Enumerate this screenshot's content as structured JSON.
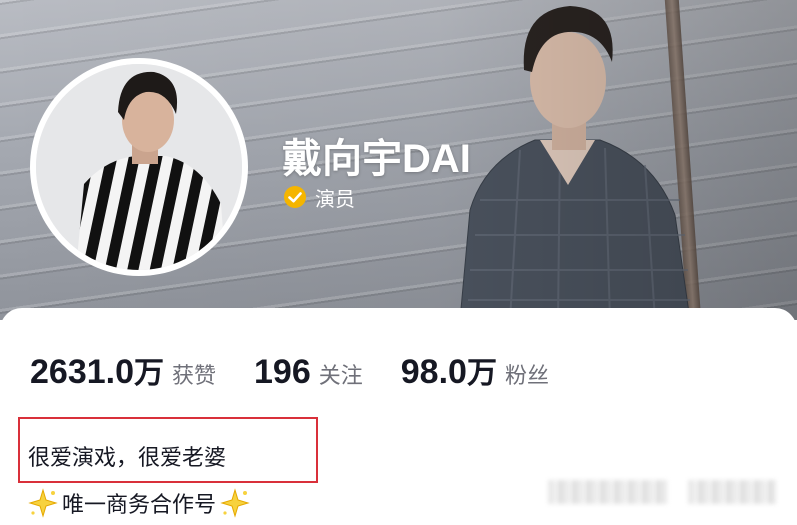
{
  "profile": {
    "name": "戴向宇DAI",
    "verified_label": "演员"
  },
  "stats": [
    {
      "number": "2631.0",
      "unit": "万",
      "label": "获赞"
    },
    {
      "number": "196",
      "unit": "",
      "label": "关注"
    },
    {
      "number": "98.0",
      "unit": "万",
      "label": "粉丝"
    }
  ],
  "bio": {
    "line1": "很爱演戏，很爱老婆",
    "line2": "唯一商务合作号"
  },
  "icons": {
    "verified": "verified-badge-icon",
    "sparkle": "sparkle-star-icon"
  },
  "colors": {
    "verified_badge": "#f5b500",
    "highlight_box": "#d9303a"
  }
}
